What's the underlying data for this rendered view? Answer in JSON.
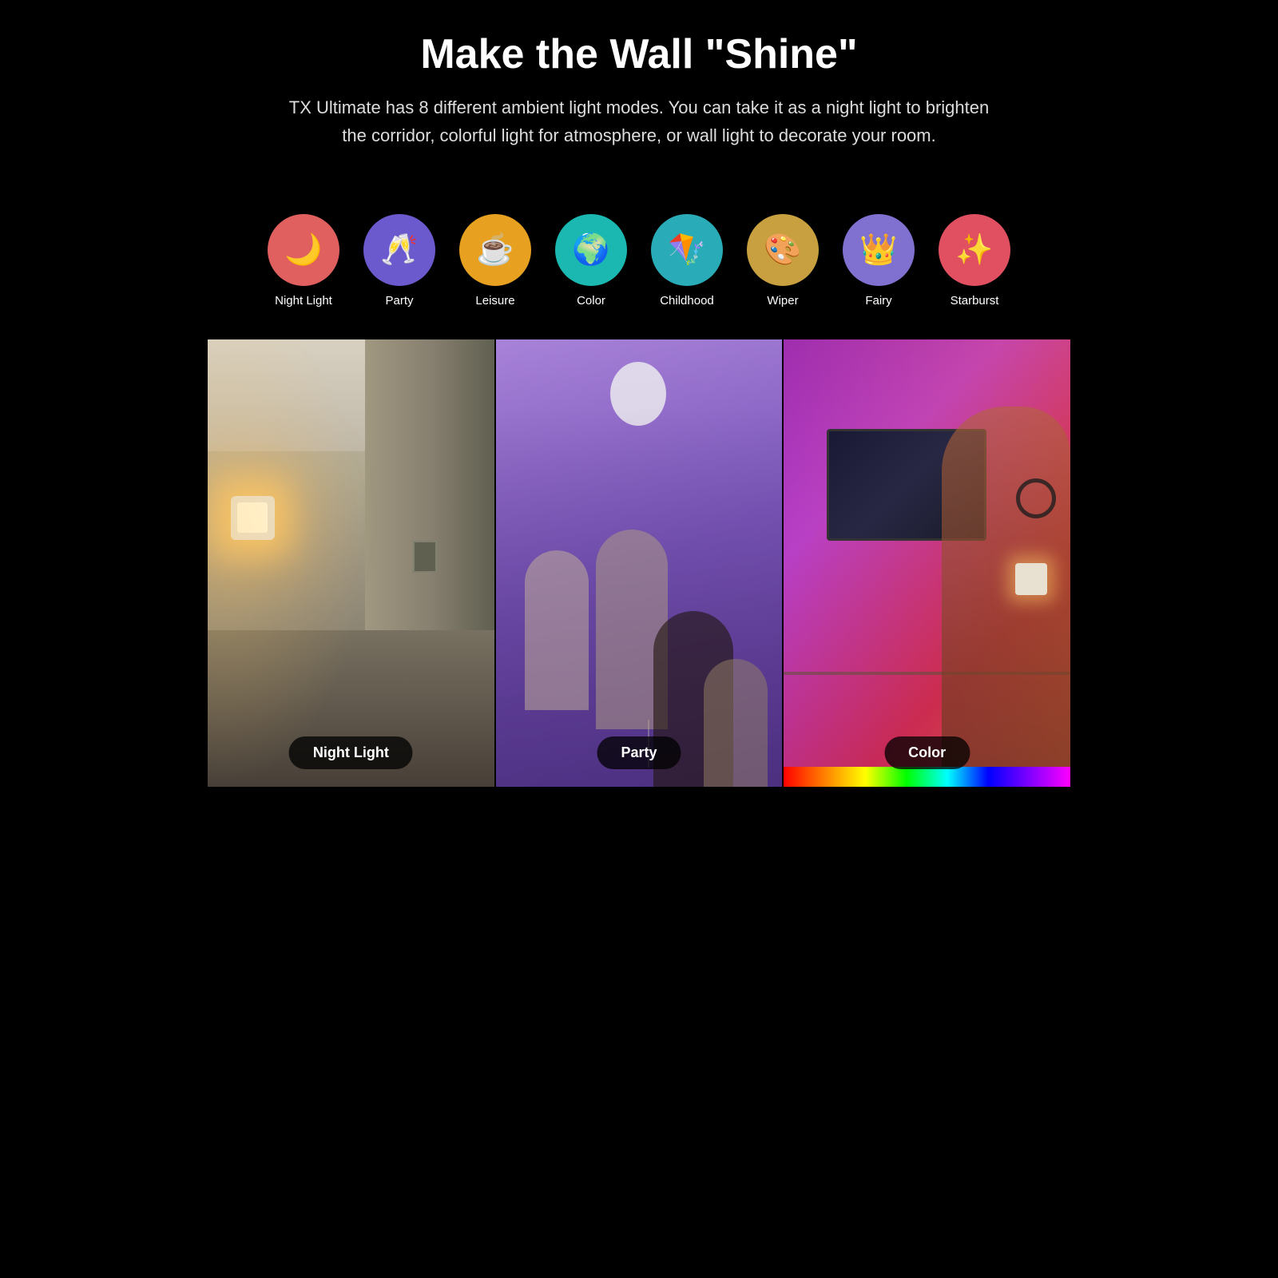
{
  "header": {
    "title": "Make the Wall \"Shine\"",
    "subtitle": "TX Ultimate has 8 different ambient light modes. You can take it as a night light to brighten the corridor, colorful light for atmosphere, or wall light to decorate your room."
  },
  "modes": [
    {
      "id": "night-light",
      "label": "Night Light",
      "icon": "🌙",
      "color_class": "night-light"
    },
    {
      "id": "party",
      "label": "Party",
      "icon": "🥂",
      "color_class": "party"
    },
    {
      "id": "leisure",
      "label": "Leisure",
      "icon": "☕",
      "color_class": "leisure"
    },
    {
      "id": "color",
      "label": "Color",
      "icon": "🌍",
      "color_class": "color"
    },
    {
      "id": "childhood",
      "label": "Childhood",
      "icon": "🪁",
      "color_class": "childhood"
    },
    {
      "id": "wiper",
      "label": "Wiper",
      "icon": "🎨",
      "color_class": "wiper"
    },
    {
      "id": "fairy",
      "label": "Fairy",
      "icon": "👑",
      "color_class": "fairy"
    },
    {
      "id": "starburst",
      "label": "Starburst",
      "icon": "✨",
      "color_class": "starburst"
    }
  ],
  "photos": [
    {
      "id": "night-light-photo",
      "label": "Night Light"
    },
    {
      "id": "party-photo",
      "label": "Party"
    },
    {
      "id": "color-photo",
      "label": "Color"
    }
  ]
}
